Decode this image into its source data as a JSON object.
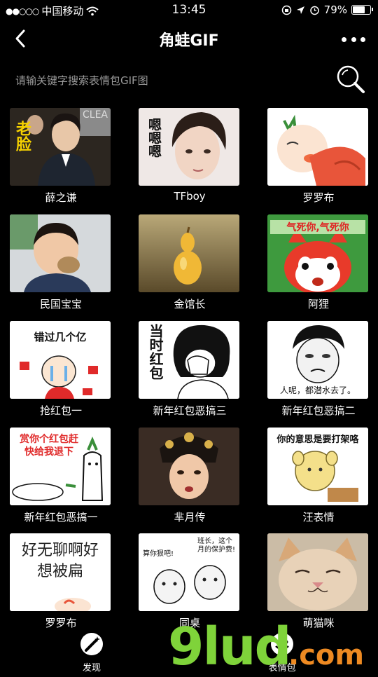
{
  "status": {
    "carrier": "中国移动",
    "time": "13:45",
    "battery": "79%",
    "battery_level": 0.79
  },
  "header": {
    "title": "角蛙GIF"
  },
  "search": {
    "placeholder": "请输关键字搜索表情包GIF图"
  },
  "items": [
    {
      "caption": "薛之谦",
      "overlay": "老脸",
      "ribbon": "CLEA"
    },
    {
      "caption": "TFboy",
      "overlay": "嗯嗯嗯"
    },
    {
      "caption": "罗罗布"
    },
    {
      "caption": "民国宝宝"
    },
    {
      "caption": "金馆长"
    },
    {
      "caption": "阿狸",
      "overlay": "气死你,气死你"
    },
    {
      "caption": "抢红包一",
      "overlay": "错过几个亿"
    },
    {
      "caption": "新年红包恶搞三",
      "overlay": "当时红包"
    },
    {
      "caption": "新年红包恶搞二",
      "overlay": "人呢，都潜水去了。"
    },
    {
      "caption": "新年红包恶搞一",
      "overlay": "赏你个红包赶快给我退下"
    },
    {
      "caption": "芈月传"
    },
    {
      "caption": "汪表情",
      "overlay": "你的意思是要打架咯"
    },
    {
      "caption": "罗罗布",
      "overlay": "好无聊啊好想被扁"
    },
    {
      "caption": "同桌",
      "overlay_a": "算你狠吧!",
      "overlay_b": "班长，这个月的保护费!"
    },
    {
      "caption": "萌猫咪"
    }
  ],
  "tabs": [
    {
      "label": "发现"
    },
    {
      "label": "表情包"
    }
  ],
  "watermark": {
    "brand": "9lud",
    "suffix": ".com"
  }
}
